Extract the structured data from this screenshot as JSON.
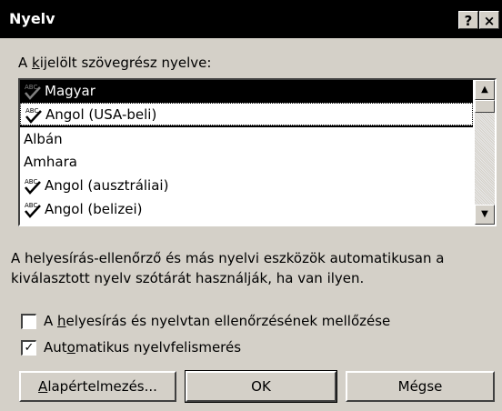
{
  "window": {
    "title": "Nyelv",
    "help_button": "?",
    "close_button": "×"
  },
  "list_label": {
    "before": "A ",
    "accel": "k",
    "after": "ijelölt szövegrész nyelve:"
  },
  "languages": [
    {
      "name": "Magyar",
      "spell_icon": true,
      "selected": true
    },
    {
      "name": "Angol (USA-beli)",
      "spell_icon": true,
      "focused": true
    },
    {
      "name": "Albán",
      "spell_icon": false
    },
    {
      "name": "Amhara",
      "spell_icon": false
    },
    {
      "name": "Angol (ausztráliai)",
      "spell_icon": true
    },
    {
      "name": "Angol (belizei)",
      "spell_icon": true
    }
  ],
  "info_text": {
    "line1": "A helyesírás-ellenőrző és más nyelvi eszközök automatikusan a",
    "line2": "kiválasztott nyelv szótárát használják, ha van ilyen."
  },
  "options": {
    "skip_check": {
      "before": "A ",
      "accel": "h",
      "after": "elyesírás és nyelvtan ellenőrzésének mellőzése",
      "checked": false
    },
    "auto_detect": {
      "before": "Aut",
      "accel": "o",
      "after": "matikus nyelvfelismerés",
      "checked": true,
      "check_glyph": "✓"
    }
  },
  "buttons": {
    "default_accel": "A",
    "default_rest": "lapértelmezés...",
    "ok": "OK",
    "cancel": "Mégse"
  },
  "scrollbar": {
    "up_arrow": "▲",
    "down_arrow": "▼"
  }
}
